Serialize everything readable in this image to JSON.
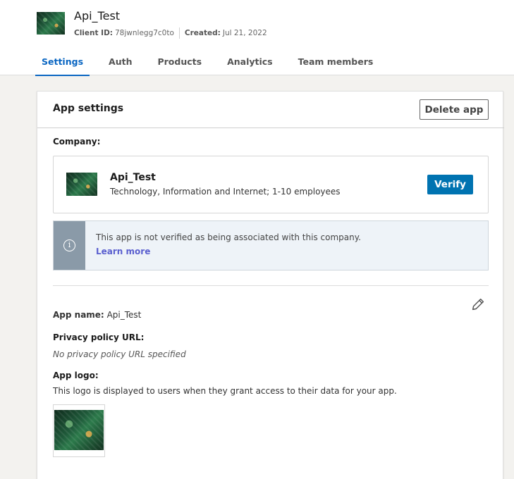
{
  "header": {
    "app_title": "Api_Test",
    "client_id_label": "Client ID:",
    "client_id": "78jwnlegg7c0to",
    "created_label": "Created:",
    "created": "Jul 21, 2022"
  },
  "tabs": [
    {
      "label": "Settings",
      "active": true
    },
    {
      "label": "Auth"
    },
    {
      "label": "Products"
    },
    {
      "label": "Analytics"
    },
    {
      "label": "Team members"
    }
  ],
  "card": {
    "title": "App settings",
    "delete_label": "Delete app",
    "company_label": "Company:",
    "company": {
      "name": "Api_Test",
      "description": "Technology, Information and Internet; 1-10 employees",
      "verify_label": "Verify"
    },
    "notice": {
      "text": "This app is not verified as being associated with this company.",
      "link": "Learn more",
      "icon": "info-icon"
    },
    "app_name_label": "App name:",
    "app_name": "Api_Test",
    "privacy_label": "Privacy policy URL:",
    "privacy_value": "No privacy policy URL specified",
    "logo_label": "App logo:",
    "logo_desc": "This logo is displayed to users when they grant access to their data for your app."
  },
  "colors": {
    "accent": "#0a66c2",
    "verify_button": "#0073b1",
    "link": "#5a5fcf",
    "notice_side": "#8a9aa8"
  }
}
